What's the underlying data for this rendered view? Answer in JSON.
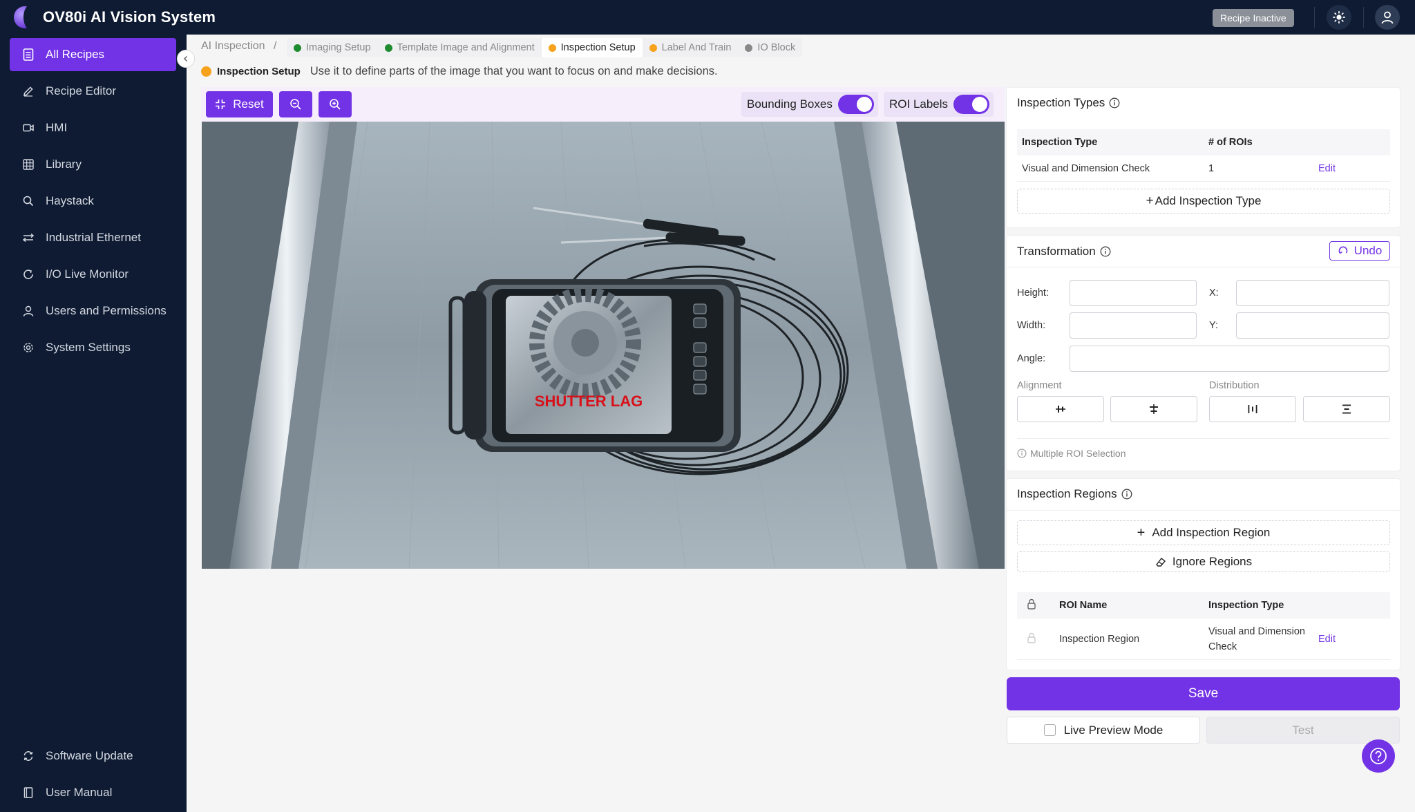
{
  "app": {
    "title": "OV80i AI Vision System",
    "status_badge": "Recipe Inactive"
  },
  "sidebar": {
    "items": [
      {
        "label": "All Recipes",
        "icon": "document-icon",
        "active": true
      },
      {
        "label": "Recipe Editor",
        "icon": "pencil-icon"
      },
      {
        "label": "HMI",
        "icon": "video-icon"
      },
      {
        "label": "Library",
        "icon": "grid-icon"
      },
      {
        "label": "Haystack",
        "icon": "search-icon"
      },
      {
        "label": "Industrial Ethernet",
        "icon": "network-icon"
      },
      {
        "label": "I/O Live Monitor",
        "icon": "refresh-icon"
      },
      {
        "label": "Users and Permissions",
        "icon": "user-icon"
      },
      {
        "label": "System Settings",
        "icon": "gear-icon"
      }
    ],
    "bottom": [
      {
        "label": "Software Update",
        "icon": "sync-icon"
      },
      {
        "label": "User Manual",
        "icon": "book-icon"
      }
    ]
  },
  "breadcrumb": {
    "root": "AI Inspection",
    "separator": "/",
    "steps": [
      {
        "label": "Imaging Setup",
        "color": "#1e8c2e"
      },
      {
        "label": "Template Image and Alignment",
        "color": "#1e8c2e"
      },
      {
        "label": "Inspection Setup",
        "color": "#f7a21c",
        "active": true
      },
      {
        "label": "Label And Train",
        "color": "#f7a21c"
      },
      {
        "label": "IO Block",
        "color": "#888888"
      }
    ]
  },
  "description": {
    "title": "Inspection Setup",
    "text": "Use it to define parts of the image that you want to focus on and make decisions."
  },
  "toolbar": {
    "reset_label": "Reset",
    "bounding_boxes_label": "Bounding Boxes",
    "bounding_boxes_on": true,
    "roi_labels_label": "ROI Labels",
    "roi_labels_on": true
  },
  "image": {
    "screen_text": "SHUTTER LAG"
  },
  "inspection_types": {
    "title": "Inspection Types",
    "columns": [
      "Inspection Type",
      "# of ROIs"
    ],
    "rows": [
      {
        "type": "Visual and Dimension Check",
        "rois": "1",
        "action": "Edit"
      }
    ],
    "add_label": "Add Inspection Type"
  },
  "transformation": {
    "title": "Transformation",
    "undo_label": "Undo",
    "fields": {
      "height": "Height:",
      "width": "Width:",
      "x": "X:",
      "y": "Y:",
      "angle": "Angle:"
    },
    "values": {
      "height": "",
      "width": "",
      "x": "",
      "y": "",
      "angle": ""
    },
    "alignment_label": "Alignment",
    "distribution_label": "Distribution",
    "hint": "Multiple ROI Selection"
  },
  "inspection_regions": {
    "title": "Inspection Regions",
    "add_label": "Add Inspection Region",
    "ignore_label": "Ignore Regions",
    "columns": [
      "ROI Name",
      "Inspection Type"
    ],
    "rows": [
      {
        "name": "Inspection Region",
        "type_line1": "Visual and Dimension",
        "type_line2": "Check",
        "action": "Edit"
      }
    ]
  },
  "actions": {
    "save_label": "Save",
    "live_preview_label": "Live Preview Mode",
    "test_label": "Test"
  },
  "colors": {
    "accent": "#7232e6",
    "nav_bg": "#0e1b33",
    "done": "#1e8c2e",
    "in_progress": "#f7a21c"
  }
}
